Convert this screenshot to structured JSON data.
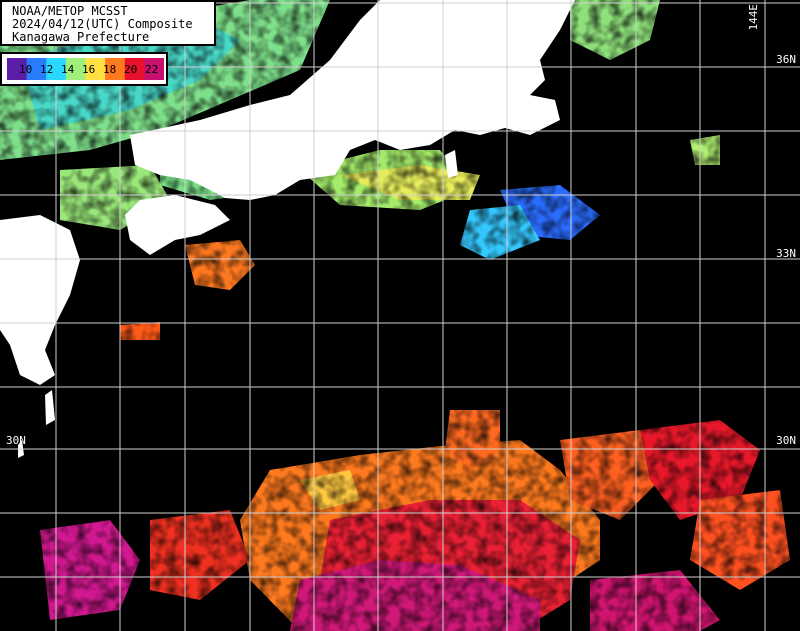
{
  "header": {
    "line1": "NOAA/METOP MCSST",
    "line2": "2024/04/12(UTC) Composite",
    "line3": "Kanagawa Prefecture"
  },
  "legend": {
    "labels": [
      "10",
      "12",
      "14",
      "16",
      "18",
      "20",
      "22"
    ],
    "colors": [
      "#5a1ea8",
      "#2a7cff",
      "#28d8ff",
      "#9ff07a",
      "#ffe040",
      "#ff7a1e",
      "#e8102a",
      "#c8106e"
    ]
  },
  "coordinates": {
    "lat_36": "36N",
    "lat_33": "33N",
    "lat_30_left": "30N",
    "lat_30_right": "30N",
    "lon_144": "144E"
  },
  "colors": {
    "land": "#ffffff",
    "no_data": "#000000",
    "grid": "#cfcfcf"
  }
}
